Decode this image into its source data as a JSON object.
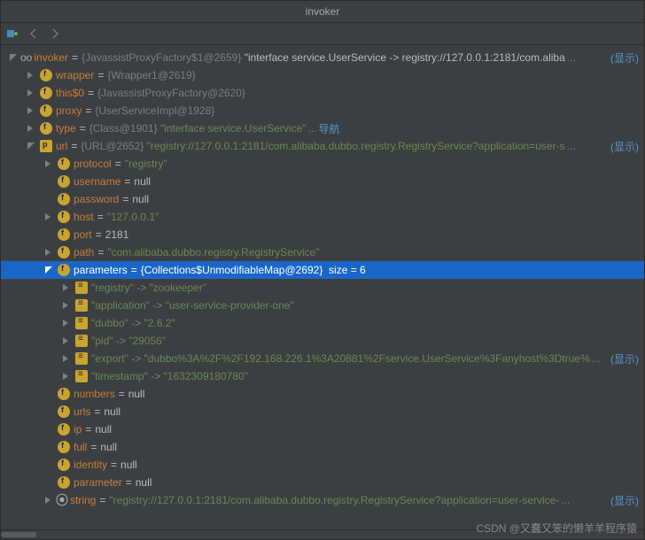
{
  "title": "invoker",
  "showMore": "(显示)",
  "ellipsis": "...",
  "nav": "导航",
  "watermark": "CSDN @又蠢又笨的懒羊羊程序猿",
  "nullVal": "null",
  "root": {
    "name": "invoker",
    "cls": "{JavassistProxyFactory$1@2659}",
    "val": "\"interface service.UserService -> registry://127.0.0.1:2181/com.aliba"
  },
  "wrapper": {
    "name": "wrapper",
    "cls": "{Wrapper1@2619}"
  },
  "this0": {
    "name": "this$0",
    "cls": "{JavassistProxyFactory@2620}"
  },
  "proxy": {
    "name": "proxy",
    "cls": "{UserServiceImpl@1928}"
  },
  "type": {
    "name": "type",
    "cls": "{Class@1901}",
    "val": "\"interface service.UserService\""
  },
  "url": {
    "name": "url",
    "cls": "{URL@2652}",
    "val": "\"registry://127.0.0.1:2181/com.alibaba.dubbo.registry.RegistryService?application=user-s"
  },
  "protocol": {
    "name": "protocol",
    "val": "\"registry\""
  },
  "username": {
    "name": "username"
  },
  "password": {
    "name": "password"
  },
  "host": {
    "name": "host",
    "val": "\"127.0.0.1\""
  },
  "port": {
    "name": "port",
    "val": "2181"
  },
  "path": {
    "name": "path",
    "val": "\"com.alibaba.dubbo.registry.RegistryService\""
  },
  "parameters": {
    "name": "parameters",
    "cls": "{Collections$UnmodifiableMap@2692}",
    "size": "size = 6",
    "items": {
      "registry": {
        "k": "\"registry\"",
        "v": "\"zookeeper\""
      },
      "application": {
        "k": "\"application\"",
        "v": "\"user-service-provider-one\""
      },
      "dubbo": {
        "k": "\"dubbo\"",
        "v": "\"2.6.2\""
      },
      "pid": {
        "k": "\"pid\"",
        "v": "\"29056\""
      },
      "export": {
        "k": "\"export\"",
        "v": "\"dubbo%3A%2F%2F192.168.226.1%3A20881%2Fservice.UserService%3Fanyhost%3Dtrue%"
      },
      "timestamp": {
        "k": "\"timestamp\"",
        "v": "\"1632309180780\""
      }
    }
  },
  "numbers": {
    "name": "numbers"
  },
  "urls": {
    "name": "urls"
  },
  "ip": {
    "name": "ip"
  },
  "full": {
    "name": "full"
  },
  "identity": {
    "name": "identity"
  },
  "parameter": {
    "name": "parameter"
  },
  "string": {
    "name": "string",
    "val": "\"registry://127.0.0.1:2181/com.alibaba.dubbo.registry.RegistryService?application=user-service-"
  }
}
